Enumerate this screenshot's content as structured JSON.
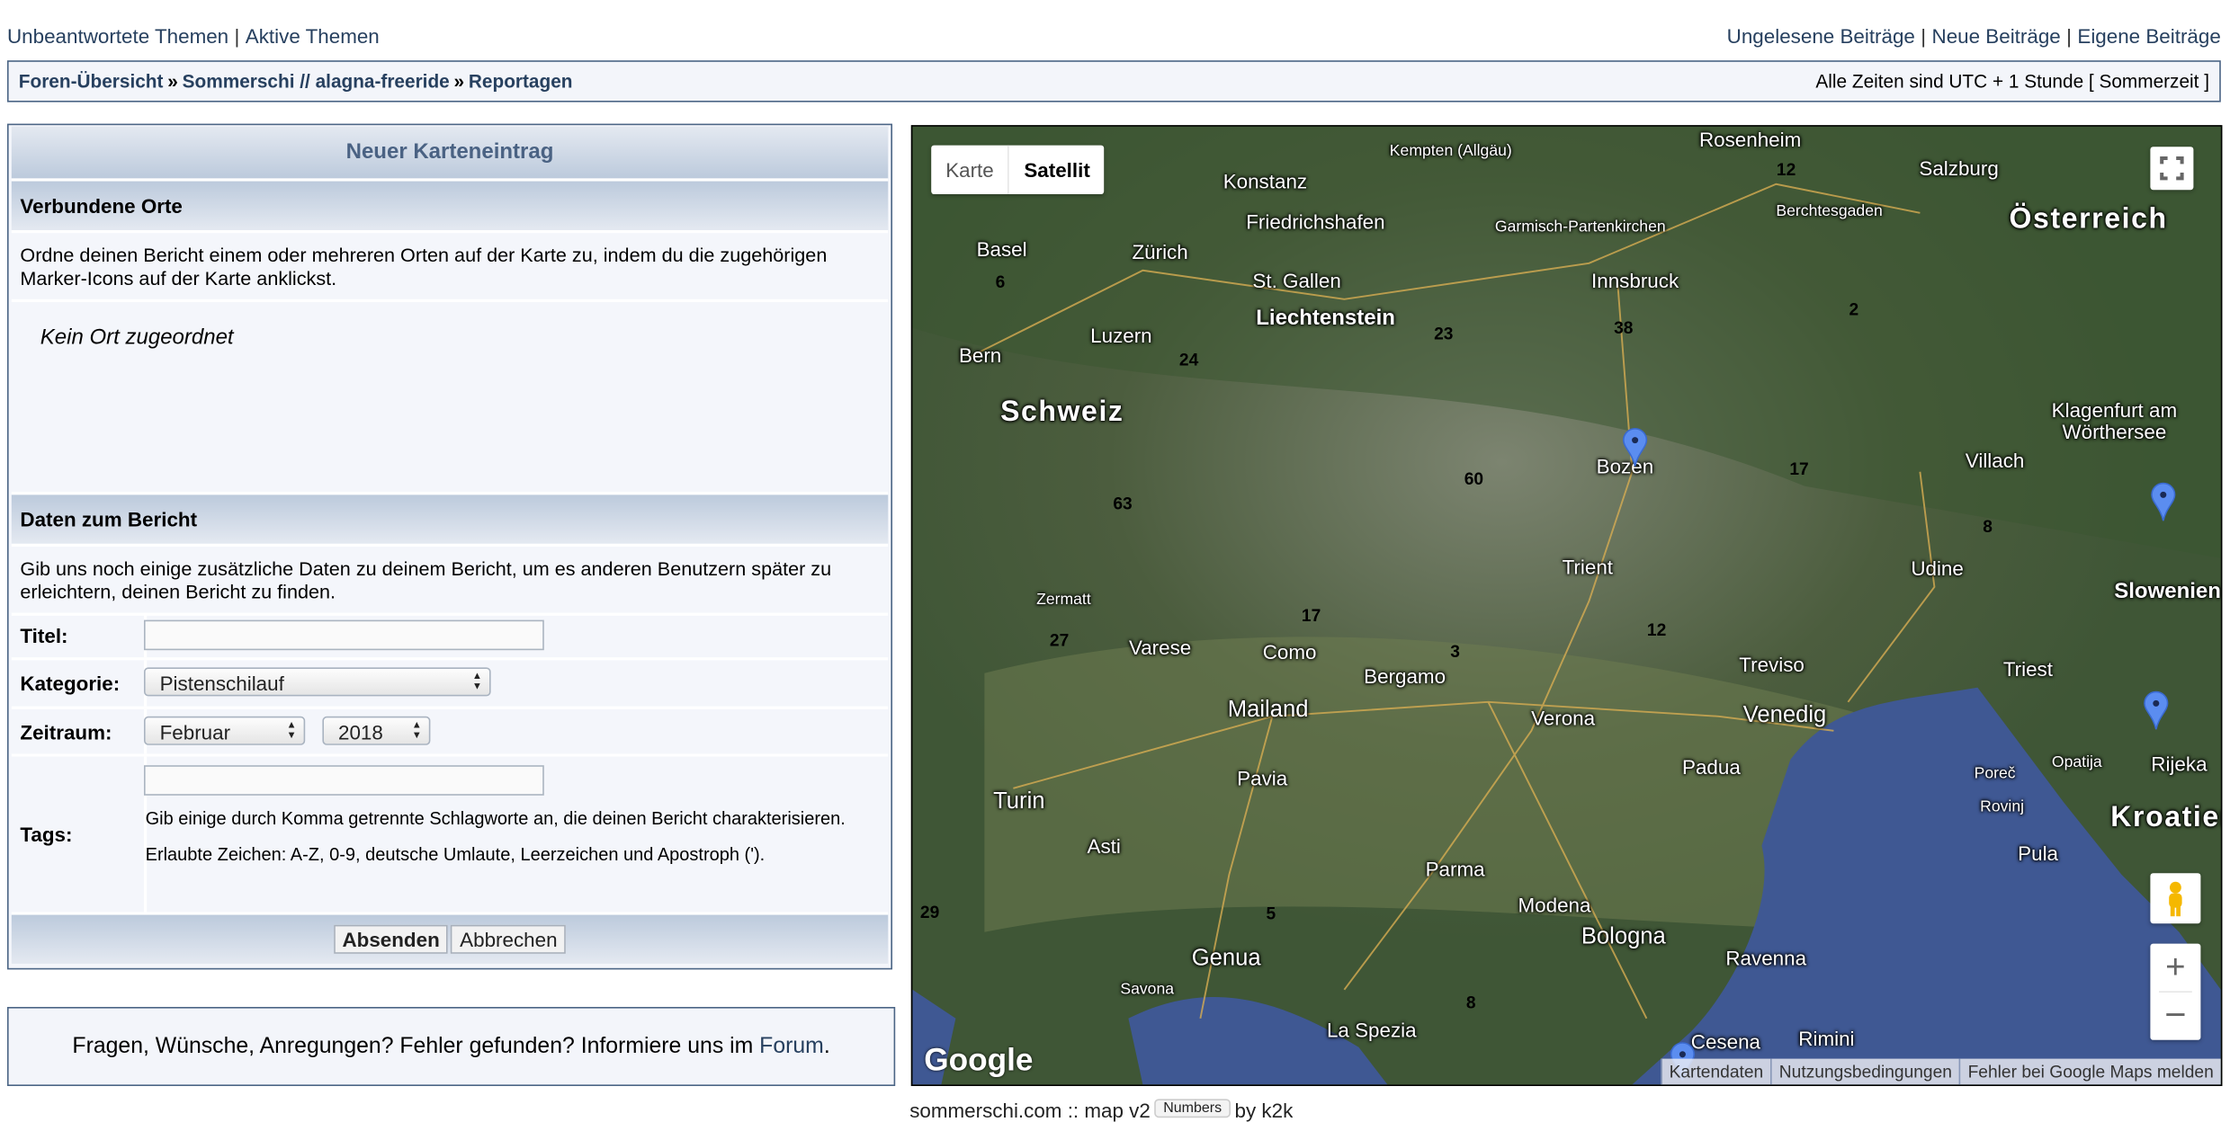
{
  "top_left_links": [
    "Unbeantwortete Themen",
    "Aktive Themen"
  ],
  "top_right_links": [
    "Ungelesene Beiträge",
    "Neue Beiträge",
    "Eigene Beiträge"
  ],
  "breadcrumb": {
    "items": [
      "Foren-Übersicht",
      "Sommerschi // alagna-freeride",
      "Reportagen"
    ],
    "separator": "»",
    "timezone": "Alle Zeiten sind UTC + 1 Stunde [ Sommerzeit ]"
  },
  "form": {
    "title": "Neuer Karteneintrag",
    "section1": {
      "title": "Verbundene Orte",
      "description": "Ordne deinen Bericht einem oder mehreren Orten auf der Karte zu, indem du die zugehörigen Marker-Icons auf der Karte anklickst.",
      "empty": "Kein Ort zugeordnet"
    },
    "section2": {
      "title": "Daten zum Bericht",
      "description": "Gib uns noch einige zusätzliche Daten zu deinem Bericht, um es anderen Benutzern später zu erleichtern, deinen Bericht zu finden."
    },
    "fields": {
      "title_label": "Titel:",
      "title_value": "",
      "category_label": "Kategorie:",
      "category_value": "Pistenschilauf",
      "period_label": "Zeitraum:",
      "month_value": "Februar",
      "year_value": "2018",
      "tags_label": "Tags:",
      "tags_value": "",
      "tags_help": "Gib einige durch Komma getrennte Schlagworte an, die deinen Bericht charakterisieren. Erlaubte Zeichen: A-Z, 0-9, deutsche Umlaute, Leerzeichen und Apostroph (')."
    },
    "submit": "Absenden",
    "cancel": "Abbrechen"
  },
  "feedback": {
    "text": "Fragen, Wünsche, Anregungen? Fehler gefunden? Informiere uns im ",
    "link": "Forum",
    "end": "."
  },
  "map": {
    "type_buttons": [
      "Karte",
      "Satellit"
    ],
    "active_type": "Satellit",
    "places": [
      "Kempten (Allgäu)",
      "Rosenheim",
      "Salzburg",
      "Österreich",
      "Konstanz",
      "Friedrichshafen",
      "Garmisch-Partenkirchen",
      "Berchtesgaden",
      "Basel",
      "Zürich",
      "St. Gallen",
      "Innsbruck",
      "Liechtenstein",
      "Luzern",
      "Bern",
      "Schweiz",
      "Klagenfurt am Wörthersee",
      "Bozen",
      "Villach",
      "Udine",
      "Trient",
      "Slowenien",
      "Zermatt",
      "Varese",
      "Como",
      "Bergamo",
      "Treviso",
      "Triest",
      "Verona",
      "Venedig",
      "Mailand",
      "Padua",
      "Poreč",
      "Opatija",
      "Rijeka",
      "Rovinj",
      "Pavia",
      "Turin",
      "Kroatien",
      "Asti",
      "Pula",
      "Parma",
      "Modena",
      "Bologna",
      "Genua",
      "Ravenna",
      "Savona",
      "La Spezia",
      "Cesena",
      "Rimini"
    ],
    "clusters": [
      "12",
      "6",
      "2",
      "23",
      "38",
      "24",
      "60",
      "17",
      "63",
      "8",
      "27",
      "17",
      "12",
      "3",
      "29",
      "5",
      "8"
    ],
    "logo": "Google",
    "attribution": [
      "Kartendaten",
      "Nutzungsbedingungen",
      "Fehler bei Google Maps melden"
    ],
    "marker_color": "#5b8df0"
  },
  "credit": {
    "text1": "sommerschi.com :: map v2",
    "tooltip": "Numbers",
    "text2": "by k2k"
  }
}
